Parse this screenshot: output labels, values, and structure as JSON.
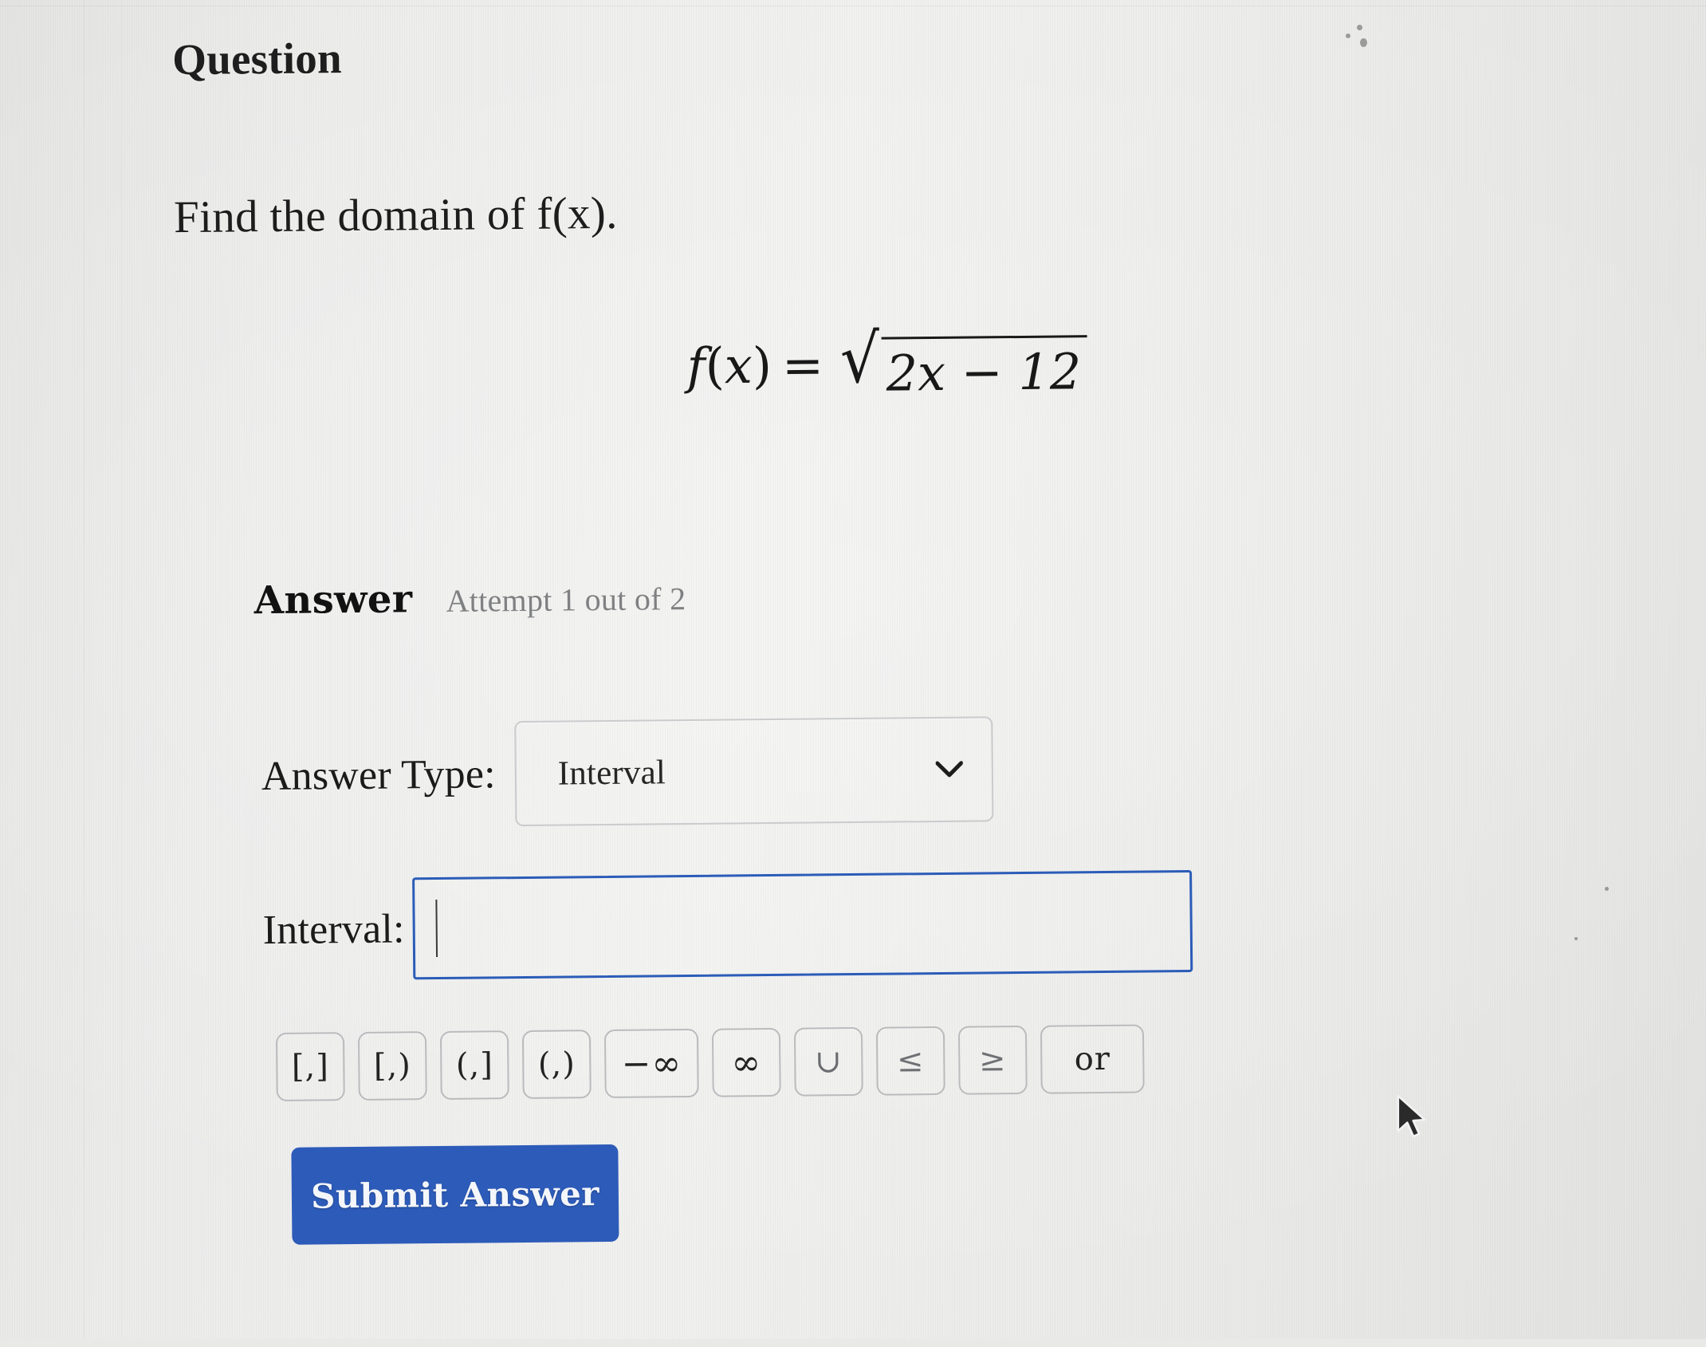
{
  "page": {
    "heading": "Question",
    "prompt": "Find the domain of f(x)."
  },
  "formula": {
    "lhs_f": "f",
    "lhs_open": "(",
    "lhs_var": "x",
    "lhs_close": ")",
    "equals": "=",
    "radical": "√",
    "radicand": "2x − 12",
    "plain": "f(x) = √(2x − 12)"
  },
  "answer": {
    "title": "Answer",
    "attempt": "Attempt 1 out of 2",
    "answer_type_label": "Answer Type:",
    "answer_type_value": "Interval",
    "answer_type_options": [
      "Interval"
    ],
    "chevron_icon": "chevron-down-icon",
    "interval_label": "Interval:",
    "interval_value": "",
    "interval_placeholder": ""
  },
  "keypad": {
    "keys": [
      {
        "label": "[,]",
        "name": "key-closed-closed"
      },
      {
        "label": "[,)",
        "name": "key-closed-open"
      },
      {
        "label": "(,]",
        "name": "key-open-closed"
      },
      {
        "label": "(,)",
        "name": "key-open-open"
      },
      {
        "label": "−∞",
        "name": "key-negative-infinity"
      },
      {
        "label": "∞",
        "name": "key-infinity"
      },
      {
        "label": "∪",
        "name": "key-union"
      },
      {
        "label": "≤",
        "name": "key-less-equal"
      },
      {
        "label": "≥",
        "name": "key-greater-equal"
      },
      {
        "label": "or",
        "name": "key-or"
      }
    ]
  },
  "submit": {
    "label": "Submit Answer"
  },
  "colors": {
    "accent_blue": "#2d5bb9",
    "input_focus_border": "#2b5cb8",
    "page_background": "#ececea",
    "text": "#1b1b1b",
    "muted_text": "#7f8082",
    "key_border": "#b9bbbd"
  }
}
